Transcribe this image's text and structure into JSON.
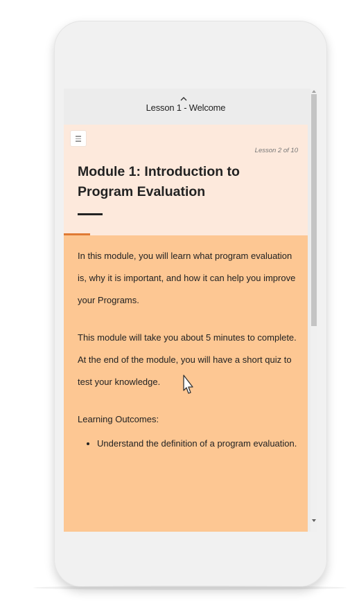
{
  "previous_lesson": {
    "label": "Lesson 1 - Welcome",
    "icon": "chevron-up-icon"
  },
  "header": {
    "menu_icon": "hamburger-menu-icon",
    "lesson_count": "Lesson 2 of 10",
    "title": "Module 1: Introduction to Program Evaluation"
  },
  "content": {
    "paragraph_1": "In this module, you will learn what program evaluation is, why it is important, and how it can help you improve your Programs.",
    "paragraph_2": "This module will take you about 5 minutes to complete. At the end of the module, you will have a short quiz to test your knowledge.",
    "outcomes_heading": "Learning Outcomes:",
    "outcomes": [
      "Understand the definition of a program evaluation."
    ]
  },
  "colors": {
    "header_bg": "#fde9dc",
    "body_bg": "#fdc793",
    "accent": "#e07a34"
  }
}
